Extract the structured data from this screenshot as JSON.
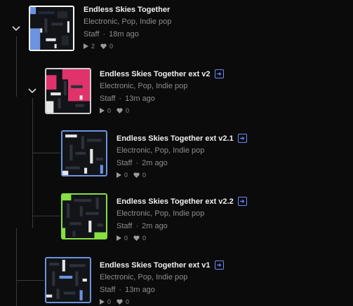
{
  "accent_colors": {
    "blue": "#6b93e0",
    "pink": "#e0336b",
    "green": "#86e042",
    "link": "#6b8cff"
  },
  "tree": [
    {
      "title": "Endless Skies Together",
      "genres": "Electronic, Pop, Indie pop",
      "author": "Staff",
      "age": "18m ago",
      "plays": "2",
      "likes": "0",
      "link_icon": false,
      "thumb_icon": "blue-maze-thumbnail"
    },
    {
      "title": "Endless Skies Together ext v2",
      "genres": "Electronic, Pop, Indie pop",
      "author": "Staff",
      "age": "13m ago",
      "plays": "0",
      "likes": "0",
      "link_icon": true,
      "thumb_icon": "pink-maze-thumbnail"
    },
    {
      "title": "Endless Skies Together ext v2.1",
      "genres": "Electronic, Pop, Indie pop",
      "author": "Staff",
      "age": "2m ago",
      "plays": "0",
      "likes": "0",
      "link_icon": true,
      "thumb_icon": "blue-maze-thumbnail"
    },
    {
      "title": "Endless Skies Together ext v2.2",
      "genres": "Electronic, Pop, Indie pop",
      "author": "Staff",
      "age": "2m ago",
      "plays": "0",
      "likes": "0",
      "link_icon": true,
      "thumb_icon": "green-maze-thumbnail"
    },
    {
      "title": "Endless Skies Together ext v1",
      "genres": "Electronic, Pop, Indie pop",
      "author": "Staff",
      "age": "13m ago",
      "plays": "0",
      "likes": "0",
      "link_icon": true,
      "thumb_icon": "blue-maze-thumbnail"
    }
  ],
  "separator": "·"
}
